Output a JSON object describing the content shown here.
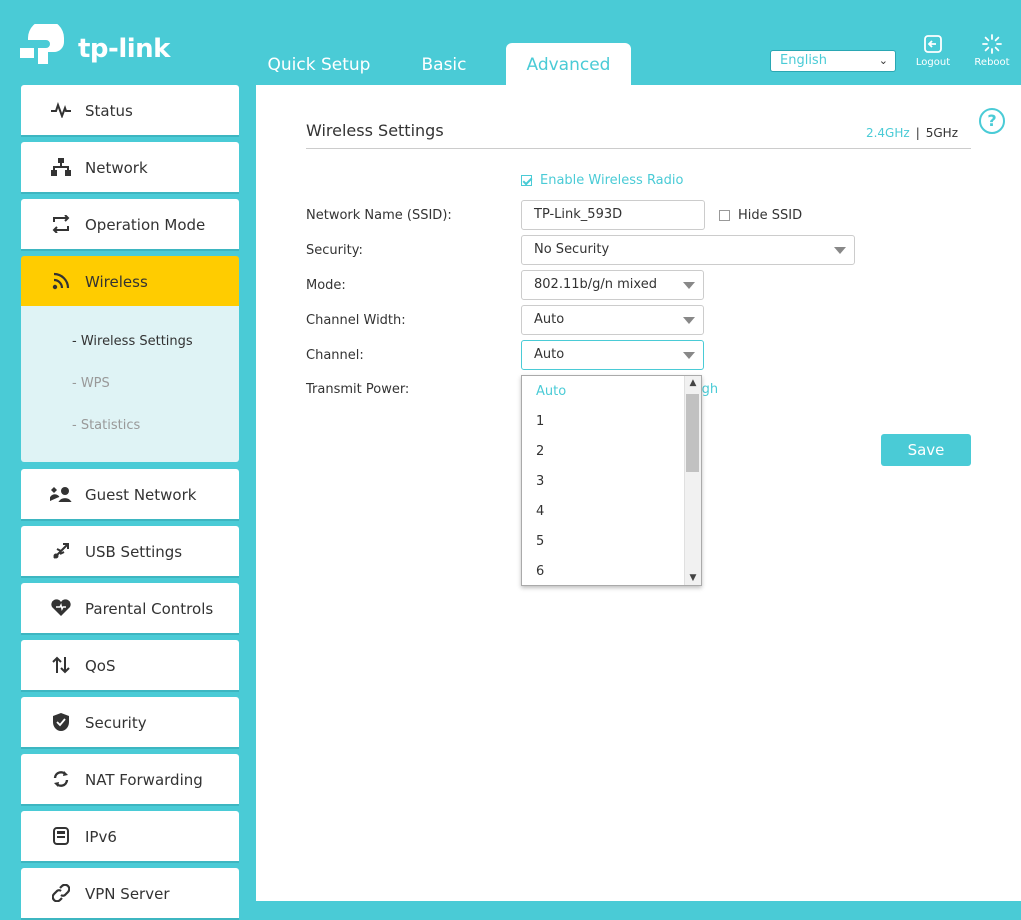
{
  "brand": {
    "logo_text": "tp-link"
  },
  "tabs": [
    {
      "label": "Quick Setup"
    },
    {
      "label": "Basic"
    },
    {
      "label": "Advanced",
      "active": true
    }
  ],
  "header": {
    "language": "English",
    "logout_label": "Logout",
    "reboot_label": "Reboot"
  },
  "sidebar": {
    "items": [
      {
        "label": "Status",
        "icon": "pulse-icon"
      },
      {
        "label": "Network",
        "icon": "network-icon"
      },
      {
        "label": "Operation Mode",
        "icon": "swap-icon"
      },
      {
        "label": "Wireless",
        "icon": "wifi-icon",
        "active": true
      },
      {
        "label": "Guest Network",
        "icon": "guests-icon"
      },
      {
        "label": "USB Settings",
        "icon": "usb-icon"
      },
      {
        "label": "Parental Controls",
        "icon": "heart-icon"
      },
      {
        "label": "QoS",
        "icon": "updown-arrows-icon"
      },
      {
        "label": "Security",
        "icon": "shield-icon"
      },
      {
        "label": "NAT Forwarding",
        "icon": "refresh-icon"
      },
      {
        "label": "IPv6",
        "icon": "document-icon"
      },
      {
        "label": "VPN Server",
        "icon": "link-icon"
      }
    ],
    "submenu": [
      {
        "label": "- Wireless Settings",
        "active": true
      },
      {
        "label": "- WPS"
      },
      {
        "label": "- Statistics"
      }
    ]
  },
  "main": {
    "title": "Wireless Settings",
    "band_24": "2.4GHz",
    "band_sep": "|",
    "band_5": "5GHz",
    "enable_radio_label": "Enable Wireless Radio",
    "fields": {
      "ssid_label": "Network Name (SSID):",
      "ssid_value": "TP-Link_593D",
      "hide_ssid_label": "Hide SSID",
      "security_label": "Security:",
      "security_value": "No Security",
      "mode_label": "Mode:",
      "mode_value": "802.11b/g/n mixed",
      "width_label": "Channel Width:",
      "width_value": "Auto",
      "channel_label": "Channel:",
      "channel_value": "Auto",
      "power_label": "Transmit Power:",
      "power_partial_visible": "igh"
    },
    "save_label": "Save",
    "channel_options": [
      "Auto",
      "1",
      "2",
      "3",
      "4",
      "5",
      "6"
    ]
  },
  "colors": {
    "accent": "#4acbd6",
    "active_nav": "#ffcc00"
  }
}
